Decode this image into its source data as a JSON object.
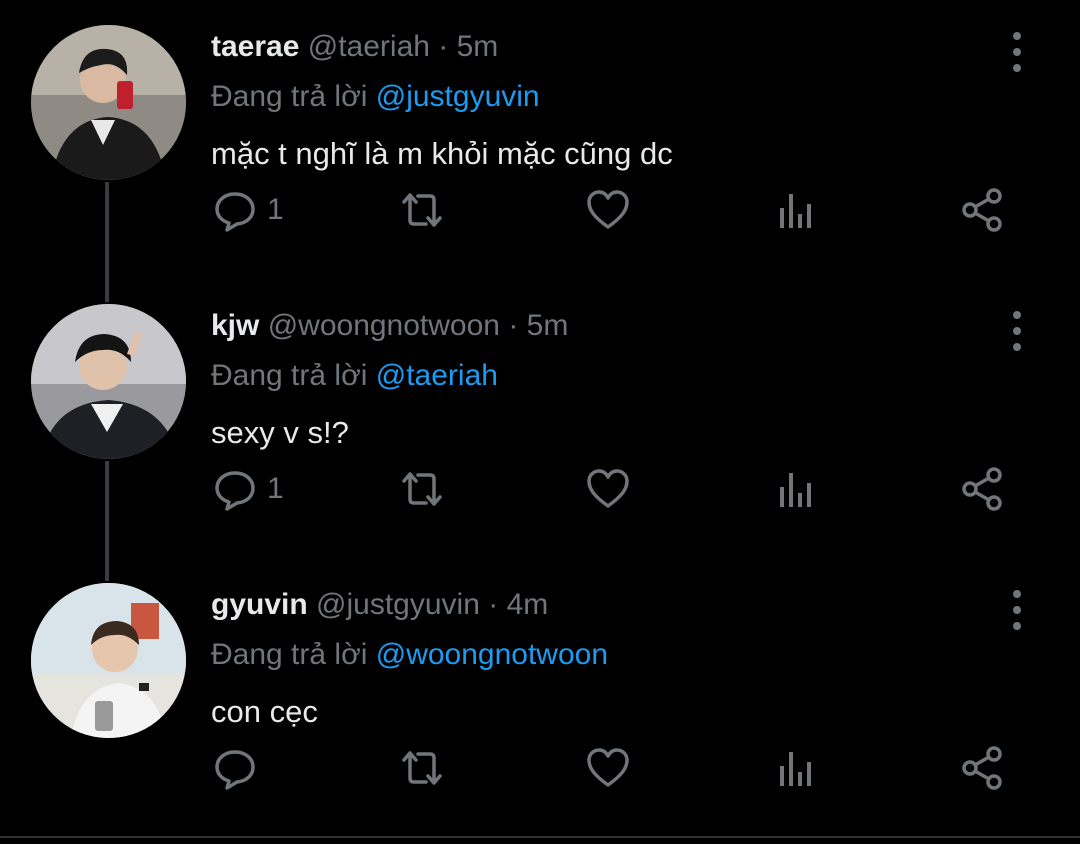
{
  "colors": {
    "background": "#000000",
    "text_primary": "#e7e9ea",
    "text_secondary": "#71767b",
    "accent": "#1d9bf0",
    "thread_line": "#3a3d40"
  },
  "tweets": [
    {
      "name": "taerae",
      "handle": "@taeriah",
      "dot": "·",
      "time": "5m",
      "reply_prefix": "Đang trả lời",
      "reply_to": "@justgyuvin",
      "text": "mặc t nghĩ là m khỏi mặc cũng dc",
      "reply_count": "1"
    },
    {
      "name": "kjw",
      "handle": "@woongnotwoon",
      "dot": "·",
      "time": "5m",
      "reply_prefix": "Đang trả lời",
      "reply_to": "@taeriah",
      "text": "sexy v s!?",
      "reply_count": "1"
    },
    {
      "name": "gyuvin",
      "handle": "@justgyuvin",
      "dot": "·",
      "time": "4m",
      "reply_prefix": "Đang trả lời",
      "reply_to": "@woongnotwoon",
      "text": "con cẹc",
      "reply_count": ""
    }
  ],
  "icons": {
    "more": "more-vertical-icon",
    "reply": "comment-icon",
    "retweet": "retweet-icon",
    "like": "heart-icon",
    "views": "analytics-icon",
    "share": "share-icon"
  }
}
